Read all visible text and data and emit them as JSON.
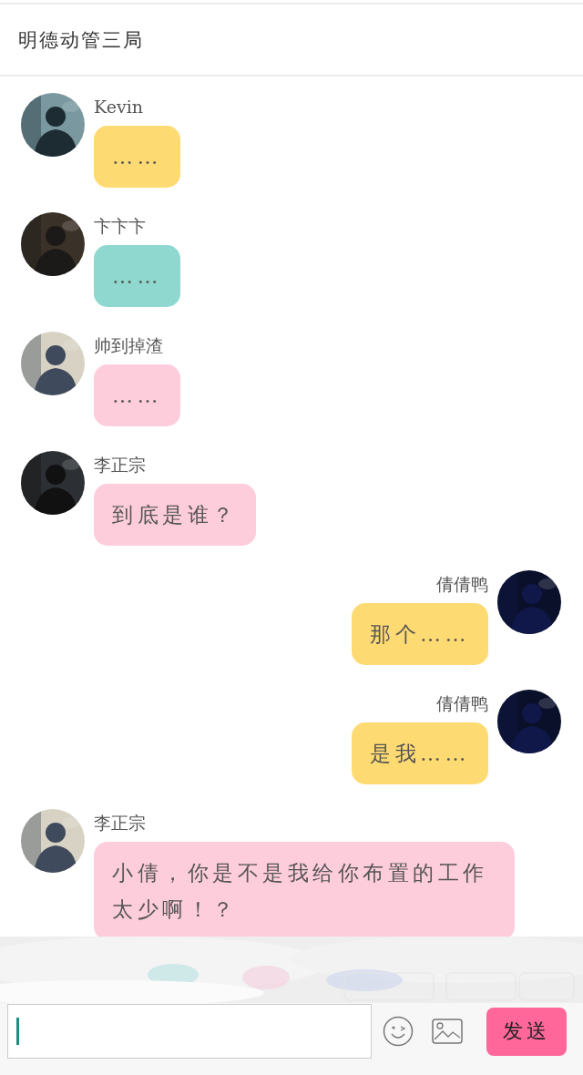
{
  "header": {
    "title": "明德动管三局"
  },
  "messages": [
    {
      "kind": "incoming",
      "name": "Kevin",
      "text": "……",
      "color": "#fedb72"
    },
    {
      "kind": "incoming",
      "name": "卞卞卞",
      "text": "……",
      "color": "#8ed8cf"
    },
    {
      "kind": "incoming",
      "name": "帅到掉渣",
      "text": "……",
      "color": "#fecddc"
    },
    {
      "kind": "incoming",
      "name": "李正宗",
      "text": "到底是谁？",
      "color": "#fecddc"
    },
    {
      "kind": "outgoing",
      "name": "倩倩鸭",
      "text": "那个……",
      "color": "#fedb72"
    },
    {
      "kind": "outgoing",
      "name": "倩倩鸭",
      "text": "是我……",
      "color": "#fedb72"
    },
    {
      "kind": "incoming",
      "name": "李正宗",
      "text": "小倩，你是不是我给你布置的工作太少啊！？",
      "color": "#fecddc"
    }
  ],
  "composer": {
    "send_button": "发送"
  }
}
